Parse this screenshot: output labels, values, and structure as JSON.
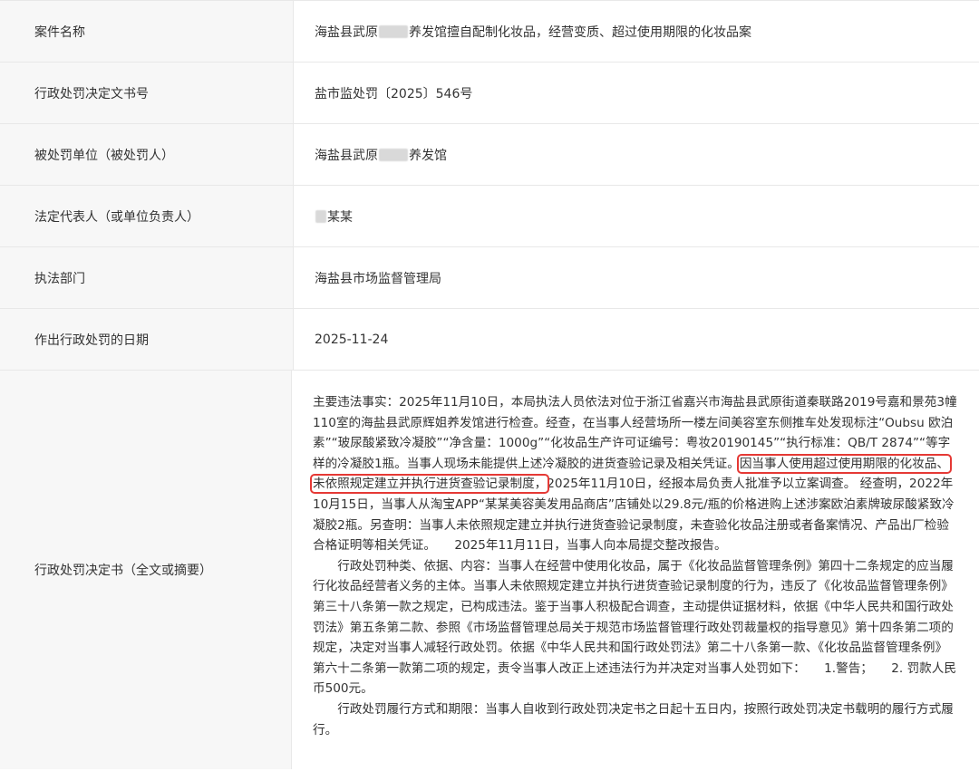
{
  "rows": [
    {
      "label": "案件名称",
      "value_pre": "海盐县武原",
      "value_post": "养发馆擅自配制化妆品，经营变质、超过使用期限的化妆品案"
    },
    {
      "label": "行政处罚决定文书号",
      "value": "盐市监处罚〔2025〕546号"
    },
    {
      "label": "被处罚单位（被处罚人）",
      "value_pre": "海盐县武原",
      "value_post": "养发馆"
    },
    {
      "label": "法定代表人（或单位负责人）",
      "value_post": "某某"
    },
    {
      "label": "执法部门",
      "value": "海盐县市场监督管理局"
    },
    {
      "label": "作出行政处罚的日期",
      "value": "2025-11-24"
    },
    {
      "label": "行政处罚决定书（全文或摘要）"
    }
  ],
  "decision": {
    "p1_a": "主要违法事实：2025年11月10日，本局执法人员依法对位于浙江省嘉兴市海盐县武原街道秦联路2019号嘉和景苑3幢110室的海盐县武原辉姐养发馆进行检查。经查，在当事人经营场所一楼左间美容室东侧推车处发现标注“Oubsu 欧泊素”“玻尿酸紧致冷凝胶”“净含量：1000g”“化妆品生产许可证编号：粤妆20190145”“执行标准：QB/T 2874”“等字样的冷凝胶1瓶。当事人现场未能提供上述冷凝胶的进货查验记录及相关凭证。",
    "p1_highlight": "因当事人使用超过使用期限的化妆品、未依照规定建立并执行进货查验记录制度，",
    "p1_b": "2025年11月10日，经报本局负责人批准予以立案调查。 经查明，2022年10月15日，当事人从淘宝APP“某某美容美发用品商店”店铺处以29.8元/瓶的价格进购上述涉案欧泊素牌玻尿酸紧致冷凝胶2瓶。另查明：当事人未依照规定建立并执行进货查验记录制度，未查验化妆品注册或者备案情况、产品出厂检验合格证明等相关凭证。　　2025年11月11日，当事人向本局提交整改报告。",
    "p2": "行政处罚种类、依据、内容：当事人在经营中使用化妆品，属于《化妆品监督管理条例》第四十二条规定的应当履行化妆品经营者义务的主体。当事人未依照规定建立并执行进货查验记录制度的行为，违反了《化妆品监督管理条例》第三十八条第一款之规定，已构成违法。鉴于当事人积极配合调查，主动提供证据材料，依据《中华人民共和国行政处罚法》第五条第二款、参照《市场监督管理总局关于规范市场监督管理行政处罚裁量权的指导意见》第十四条第二项的规定，决定对当事人减轻行政处罚。依据《中华人民共和国行政处罚法》第二十八条第一款、《化妆品监督管理条例》第六十二条第一款第二项的规定，责令当事人改正上述违法行为并决定对当事人处罚如下：　　1.警告；　　2. 罚款人民币500元。",
    "p3": "行政处罚履行方式和期限：当事人自收到行政处罚决定书之日起十五日内，按照行政处罚决定书载明的履行方式履行。"
  },
  "colors": {
    "highlight_box": "#e53935",
    "label_bg": "#f7f7f7",
    "border": "#e8e8e8"
  }
}
